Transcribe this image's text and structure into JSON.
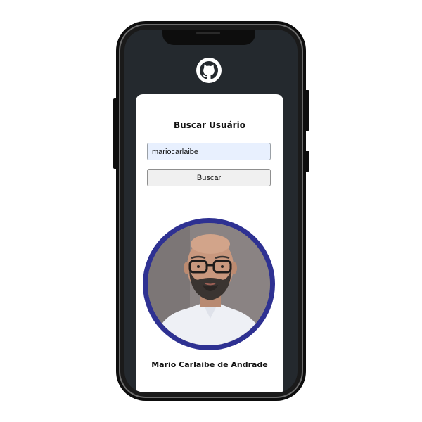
{
  "app": {
    "logo_icon": "github-icon"
  },
  "search": {
    "title": "Buscar Usuário",
    "input_value": "mariocarlaibe",
    "button_label": "Buscar"
  },
  "profile": {
    "avatar_icon": "user-avatar-photo",
    "name": "Mario Carlaibe de Andrade",
    "avatar_border_color": "#2e3192"
  },
  "colors": {
    "header_background": "#24292e",
    "card_background": "#ffffff",
    "input_background": "#e8f0fe"
  }
}
